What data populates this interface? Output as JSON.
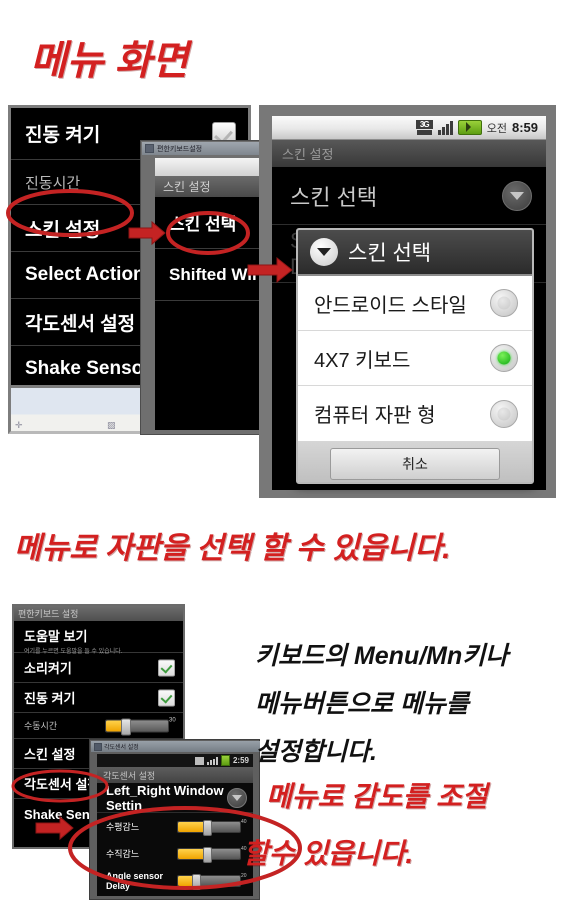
{
  "headings": {
    "title": "메뉴 화면",
    "caption_middle": "메뉴로 자판을 선택 할 수 있읍니다.",
    "note_line1": "키보드의 Menu/Mn키나",
    "note_line2": "메뉴버튼으로 메뉴를",
    "note_line3": "설정합니다.",
    "caption_bottom_line1": "메뉴로 감도를 조절",
    "caption_bottom_line2": "할수 있읍니다."
  },
  "panel_a": {
    "items": [
      {
        "label": "진동 켜기",
        "type": "checkbox",
        "checked": true
      },
      {
        "label": "진동시간",
        "type": "sub"
      },
      {
        "label": "스킨 설정",
        "type": "item",
        "annotated": true
      },
      {
        "label": "Select Action",
        "type": "item"
      },
      {
        "label": "각도센서 설정",
        "type": "item"
      },
      {
        "label": "Shake Sensor Se",
        "type": "item"
      }
    ]
  },
  "panel_b": {
    "window_title": "편한키보드설정",
    "header": "스킨 설정",
    "items": [
      {
        "label": "스킨 선택",
        "annotated": true
      },
      {
        "label": "Shifted Win"
      }
    ]
  },
  "panel_c": {
    "statusbar": {
      "network": "3G",
      "ampm": "오전",
      "time": "8:59"
    },
    "titlebar": "스킨 설정",
    "rows": [
      {
        "label": "스킨 선택",
        "control": "dropdown"
      },
      {
        "label": "Shifted Window Display",
        "control": "check",
        "dimmed": true
      }
    ],
    "dialog": {
      "title": "스킨 선택",
      "options": [
        {
          "label": "안드로이드 스타일",
          "selected": false
        },
        {
          "label": "4X7 키보드",
          "selected": true
        },
        {
          "label": "컴퓨터 자판 형",
          "selected": false
        }
      ],
      "cancel_label": "취소"
    }
  },
  "panel_d": {
    "header": "편한키보드 설정",
    "rows": [
      {
        "label": "도움말 보기",
        "sublabel": "여기를 누르면 도움말을 들 수 있습니다.",
        "type": "help"
      },
      {
        "label": "소리켜기",
        "type": "checkbox",
        "checked": true
      },
      {
        "label": "진동 켜기",
        "type": "checkbox",
        "checked": true
      },
      {
        "label": "수동시간",
        "type": "slider",
        "value": 30,
        "value_text": "30"
      },
      {
        "label": "스킨 설정",
        "type": "item"
      },
      {
        "label": "각도센서 설정",
        "type": "item",
        "annotated": true
      },
      {
        "label": "Shake Sensor Se",
        "type": "item"
      }
    ]
  },
  "panel_e": {
    "window_title": "각도센서 설정",
    "statusbar": {
      "time": "2:59"
    },
    "header": "각도센서 설정",
    "title_row": "Left_Right Window Settin",
    "sliders": [
      {
        "label": "수평감느",
        "value": 40,
        "value_text": "40"
      },
      {
        "label": "수직감느",
        "value": 40,
        "value_text": "40"
      },
      {
        "label": "Angle sensor Delay",
        "value": 22,
        "value_text": "20",
        "bold": true
      }
    ]
  }
}
